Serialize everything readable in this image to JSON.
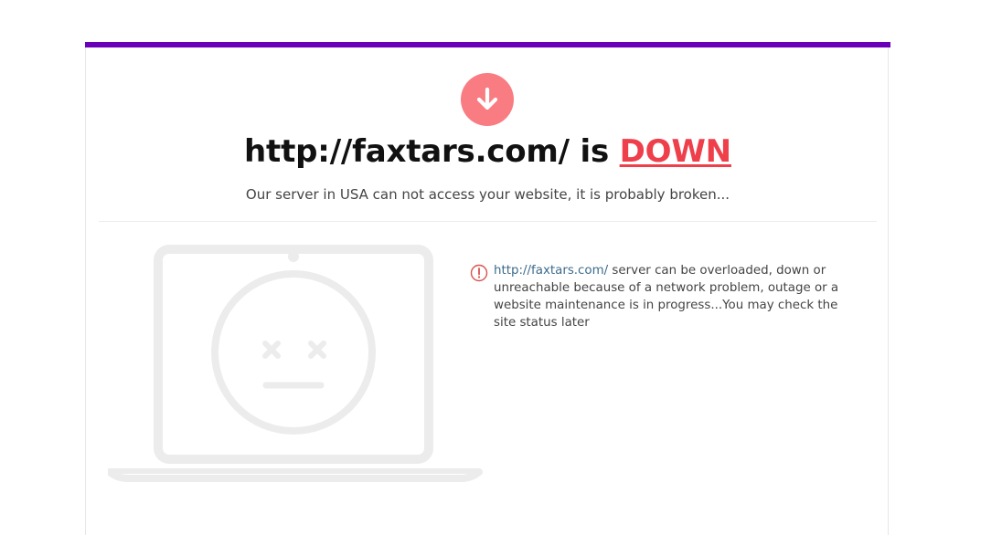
{
  "colors": {
    "top_bar": "#6a00b8",
    "down_badge": "#f97c82",
    "down_text": "#ee3f4b",
    "link": "#3d6b8c",
    "alert_icon": "#d9534f",
    "illustration": "#ececec"
  },
  "header": {
    "icon": "arrow-down-icon",
    "url": "http://faxtars.com/",
    "is_text": " is ",
    "status": "DOWN",
    "subtitle": "Our server in USA can not access your website, it is probably broken..."
  },
  "illustration": {
    "icon": "broken-laptop-face-icon"
  },
  "message": {
    "icon": "exclamation-circle-icon",
    "link_text": "http://faxtars.com/",
    "body": " server can be overloaded, down or unreachable because of a network problem, outage or a website maintenance is in progress...You may check the site status later"
  }
}
